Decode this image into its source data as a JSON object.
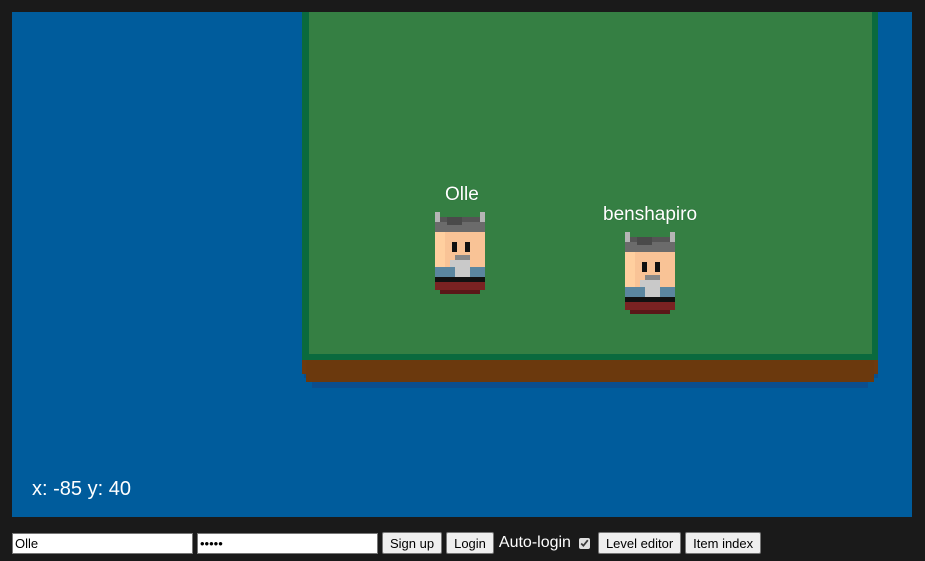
{
  "game": {
    "colors": {
      "water": "#005c9c",
      "grass": "#357f43",
      "grass_edge": "#0a6a3e",
      "dirt": "#6e3a0d"
    },
    "players": [
      {
        "name": "Olle",
        "icon": "viking-avatar-icon"
      },
      {
        "name": "benshapiro",
        "icon": "viking-avatar-icon"
      }
    ],
    "coords_text": "x: -85 y: 40"
  },
  "toolbar": {
    "username_value": "Olle",
    "password_value": "•••••",
    "signup_label": "Sign up",
    "login_label": "Login",
    "autologin_label": "Auto-login",
    "autologin_checked": true,
    "level_editor_label": "Level editor",
    "item_index_label": "Item index"
  }
}
